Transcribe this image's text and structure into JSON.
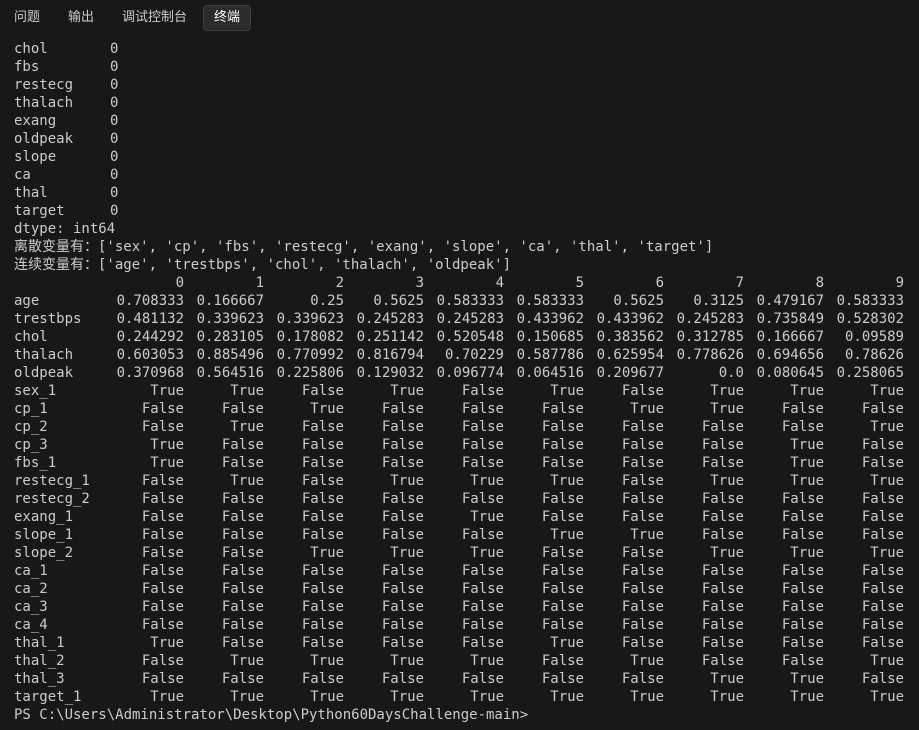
{
  "tabs": [
    {
      "label": "问题",
      "active": false
    },
    {
      "label": "输出",
      "active": false
    },
    {
      "label": "调试控制台",
      "active": false
    },
    {
      "label": "终端",
      "active": true
    }
  ],
  "null_counts": [
    {
      "name": "chol",
      "value": "0"
    },
    {
      "name": "fbs",
      "value": "0"
    },
    {
      "name": "restecg",
      "value": "0"
    },
    {
      "name": "thalach",
      "value": "0"
    },
    {
      "name": "exang",
      "value": "0"
    },
    {
      "name": "oldpeak",
      "value": "0"
    },
    {
      "name": "slope",
      "value": "0"
    },
    {
      "name": "ca",
      "value": "0"
    },
    {
      "name": "thal",
      "value": "0"
    },
    {
      "name": "target",
      "value": "0"
    }
  ],
  "dtype_line": "dtype: int64",
  "discrete_line": "离散变量有：['sex', 'cp', 'fbs', 'restecg', 'exang', 'slope', 'ca', 'thal', 'target']",
  "continuous_line": "连续变量有：['age', 'trestbps', 'chol', 'thalach', 'oldpeak']",
  "table": {
    "columns": [
      "0",
      "1",
      "2",
      "3",
      "4",
      "5",
      "6",
      "7",
      "8",
      "9"
    ],
    "rows": [
      {
        "label": "age",
        "cells": [
          "0.708333",
          "0.166667",
          "0.25",
          "0.5625",
          "0.583333",
          "0.583333",
          "0.5625",
          "0.3125",
          "0.479167",
          "0.583333"
        ]
      },
      {
        "label": "trestbps",
        "cells": [
          "0.481132",
          "0.339623",
          "0.339623",
          "0.245283",
          "0.245283",
          "0.433962",
          "0.433962",
          "0.245283",
          "0.735849",
          "0.528302"
        ]
      },
      {
        "label": "chol",
        "cells": [
          "0.244292",
          "0.283105",
          "0.178082",
          "0.251142",
          "0.520548",
          "0.150685",
          "0.383562",
          "0.312785",
          "0.166667",
          "0.09589"
        ]
      },
      {
        "label": "thalach",
        "cells": [
          "0.603053",
          "0.885496",
          "0.770992",
          "0.816794",
          "0.70229",
          "0.587786",
          "0.625954",
          "0.778626",
          "0.694656",
          "0.78626"
        ]
      },
      {
        "label": "oldpeak",
        "cells": [
          "0.370968",
          "0.564516",
          "0.225806",
          "0.129032",
          "0.096774",
          "0.064516",
          "0.209677",
          "0.0",
          "0.080645",
          "0.258065"
        ]
      },
      {
        "label": "sex_1",
        "cells": [
          "True",
          "True",
          "False",
          "True",
          "False",
          "True",
          "False",
          "True",
          "True",
          "True"
        ]
      },
      {
        "label": "cp_1",
        "cells": [
          "False",
          "False",
          "True",
          "False",
          "False",
          "False",
          "True",
          "True",
          "False",
          "False"
        ]
      },
      {
        "label": "cp_2",
        "cells": [
          "False",
          "True",
          "False",
          "False",
          "False",
          "False",
          "False",
          "False",
          "False",
          "True"
        ]
      },
      {
        "label": "cp_3",
        "cells": [
          "True",
          "False",
          "False",
          "False",
          "False",
          "False",
          "False",
          "False",
          "True",
          "False"
        ]
      },
      {
        "label": "fbs_1",
        "cells": [
          "True",
          "False",
          "False",
          "False",
          "False",
          "False",
          "False",
          "False",
          "True",
          "False"
        ]
      },
      {
        "label": "restecg_1",
        "cells": [
          "False",
          "True",
          "False",
          "True",
          "True",
          "True",
          "False",
          "True",
          "True",
          "True"
        ]
      },
      {
        "label": "restecg_2",
        "cells": [
          "False",
          "False",
          "False",
          "False",
          "False",
          "False",
          "False",
          "False",
          "False",
          "False"
        ]
      },
      {
        "label": "exang_1",
        "cells": [
          "False",
          "False",
          "False",
          "False",
          "True",
          "False",
          "False",
          "False",
          "False",
          "False"
        ]
      },
      {
        "label": "slope_1",
        "cells": [
          "False",
          "False",
          "False",
          "False",
          "False",
          "True",
          "True",
          "False",
          "False",
          "False"
        ]
      },
      {
        "label": "slope_2",
        "cells": [
          "False",
          "False",
          "True",
          "True",
          "True",
          "False",
          "False",
          "True",
          "True",
          "True"
        ]
      },
      {
        "label": "ca_1",
        "cells": [
          "False",
          "False",
          "False",
          "False",
          "False",
          "False",
          "False",
          "False",
          "False",
          "False"
        ]
      },
      {
        "label": "ca_2",
        "cells": [
          "False",
          "False",
          "False",
          "False",
          "False",
          "False",
          "False",
          "False",
          "False",
          "False"
        ]
      },
      {
        "label": "ca_3",
        "cells": [
          "False",
          "False",
          "False",
          "False",
          "False",
          "False",
          "False",
          "False",
          "False",
          "False"
        ]
      },
      {
        "label": "ca_4",
        "cells": [
          "False",
          "False",
          "False",
          "False",
          "False",
          "False",
          "False",
          "False",
          "False",
          "False"
        ]
      },
      {
        "label": "thal_1",
        "cells": [
          "True",
          "False",
          "False",
          "False",
          "False",
          "True",
          "False",
          "False",
          "False",
          "False"
        ]
      },
      {
        "label": "thal_2",
        "cells": [
          "False",
          "True",
          "True",
          "True",
          "True",
          "False",
          "True",
          "False",
          "False",
          "True"
        ]
      },
      {
        "label": "thal_3",
        "cells": [
          "False",
          "False",
          "False",
          "False",
          "False",
          "False",
          "False",
          "True",
          "True",
          "False"
        ]
      },
      {
        "label": "target_1",
        "cells": [
          "True",
          "True",
          "True",
          "True",
          "True",
          "True",
          "True",
          "True",
          "True",
          "True"
        ]
      }
    ]
  },
  "prompt": "PS C:\\Users\\Administrator\\Desktop\\Python60DaysChallenge-main>"
}
